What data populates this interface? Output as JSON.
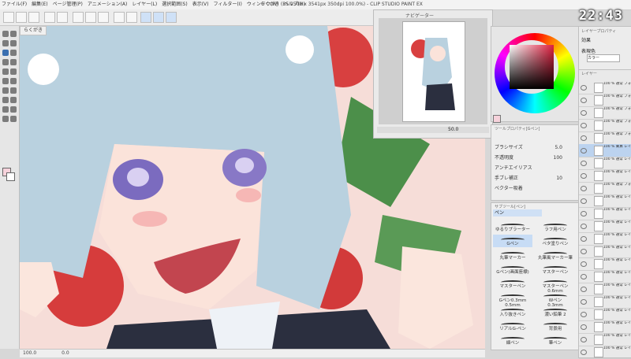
{
  "window": {
    "title": "らくがき (B5 2508 x 3541px 350dpi 100.0%) - CLIP STUDIO PAINT EX",
    "menu": [
      "ファイル(F)",
      "編集(E)",
      "ページ管理(P)",
      "アニメーション(A)",
      "レイヤー(L)",
      "選択範囲(S)",
      "表示(V)",
      "フィルター(I)",
      "ウィンドウ(W)",
      "ヘルプ(H)"
    ]
  },
  "clock": "22:43",
  "canvas": {
    "tab_label": "らくがき",
    "zoom": "100.0",
    "status": "0.0"
  },
  "navigator": {
    "title": "ナビゲーター",
    "zoom": "50.0",
    "angle": "0.0"
  },
  "color": {
    "panel_title": "カラーサークル",
    "current": "#f6d2db"
  },
  "layer_property": {
    "title": "レイヤープロパティ",
    "effect": "効果",
    "expression": "表現色",
    "expression_value": "カラー"
  },
  "tool_property": {
    "title": "ツールプロパティ[Gペン]",
    "rows": [
      {
        "label": "ブラシサイズ",
        "value": "5.0"
      },
      {
        "label": "不透明度",
        "value": "100"
      },
      {
        "label": "アンチエイリアス",
        "value": ""
      },
      {
        "label": "手ブレ補正",
        "value": "10"
      },
      {
        "label": "ベクター吸着",
        "value": ""
      }
    ]
  },
  "sub_tool": {
    "title": "サブツール[ペン]",
    "group": "ペン",
    "brushes": [
      "ゆるりプラーター",
      "ラフ用ペン",
      "Gペン",
      "ベタ塗りペン",
      "丸筆マーカー",
      "丸筆風マーカー筆",
      "Gペン(画面座標)",
      "マスターペン 0.6mm",
      "マスターペン 0.5mm",
      "マスターペン 0.3mm",
      "Gペン0.3mm",
      "Wペン",
      "入り抜きペン",
      "濃い鉛筆 2",
      "リアルG-ペン",
      "背景用",
      "細ペン",
      "筆ペン",
      "背景ブラシ",
      "アニメーター推奨ペン"
    ]
  },
  "layers": {
    "title": "レイヤー",
    "items": [
      {
        "label": "100 % 通常 フォルダー 1"
      },
      {
        "label": "100 % 通常 フォルダー 2"
      },
      {
        "label": "100 % 通常 フォルダー 3"
      },
      {
        "label": "100 % 通常 フォルダー 4"
      },
      {
        "label": "100 % 通常 フォルダー 5"
      },
      {
        "label": "100 % 乗算 レイヤー 318"
      },
      {
        "label": "100 % 通常 レイヤー 317"
      },
      {
        "label": "100 % 通常 レイヤー 298"
      },
      {
        "label": "100 % 通常 フォルダー 19"
      },
      {
        "label": "100 % 通常 レイヤー 312"
      },
      {
        "label": "100 % 通常 レイヤー 311"
      },
      {
        "label": "100 % 通常 レイヤー 304"
      },
      {
        "label": "100 % 通常 レイヤー 303"
      },
      {
        "label": "100 % 通常 レイヤー 302"
      },
      {
        "label": "100 % 通常 レイヤー 301"
      },
      {
        "label": "100 % 通常 レイヤー 300"
      },
      {
        "label": "100 % 通常 レイヤー 299"
      },
      {
        "label": "100 % 通常 レイヤー 296"
      },
      {
        "label": "100 % 通常 レイヤー 297"
      },
      {
        "label": "100 % 通常 レイヤー 295"
      },
      {
        "label": "100 % 通常 レイヤー 294"
      },
      {
        "label": "100 % 通常 レイヤー 293"
      }
    ]
  }
}
